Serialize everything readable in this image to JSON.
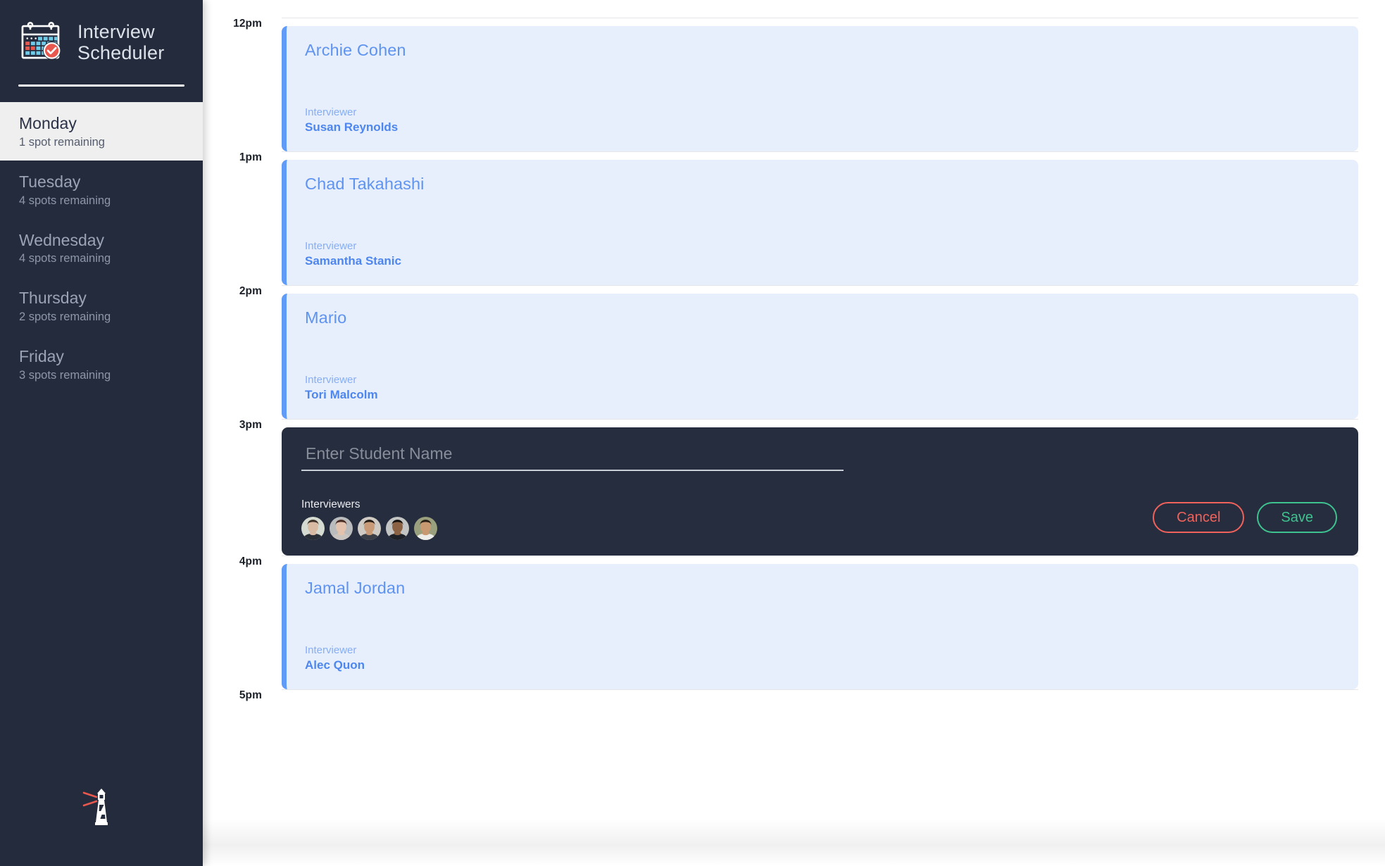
{
  "app": {
    "title_line1": "Interview",
    "title_line2": "Scheduler",
    "logo_icon": "calendar-check-icon",
    "footer_icon": "lighthouse-icon"
  },
  "sidebar": {
    "items": [
      {
        "day": "Monday",
        "spots": "1 spot remaining",
        "selected": true
      },
      {
        "day": "Tuesday",
        "spots": "4 spots remaining",
        "selected": false
      },
      {
        "day": "Wednesday",
        "spots": "4 spots remaining",
        "selected": false
      },
      {
        "day": "Thursday",
        "spots": "2 spots remaining",
        "selected": false
      },
      {
        "day": "Friday",
        "spots": "3 spots remaining",
        "selected": false
      }
    ]
  },
  "schedule": {
    "interviewer_label": "Interviewer",
    "hours": [
      {
        "time": "12pm",
        "type": "appointment",
        "student": "Archie Cohen",
        "interviewer": "Susan Reynolds"
      },
      {
        "time": "1pm",
        "type": "appointment",
        "student": "Chad Takahashi",
        "interviewer": "Samantha Stanic"
      },
      {
        "time": "2pm",
        "type": "appointment",
        "student": "Mario",
        "interviewer": "Tori Malcolm"
      },
      {
        "time": "3pm",
        "type": "form"
      },
      {
        "time": "4pm",
        "type": "appointment",
        "student": "Jamal Jordan",
        "interviewer": "Alec Quon"
      },
      {
        "time": "5pm",
        "type": "empty"
      }
    ]
  },
  "form": {
    "student_placeholder": "Enter Student Name",
    "student_value": "",
    "interviewers_label": "Interviewers",
    "cancel_label": "Cancel",
    "save_label": "Save",
    "interviewers": [
      {
        "name": "interviewer-avatar-1",
        "skin": "#D9BBA4",
        "hair": "#3E3228",
        "shirt": "#2A2E36",
        "bg": "#D6DBD2"
      },
      {
        "name": "interviewer-avatar-2",
        "skin": "#E3C3AE",
        "hair": "#4A2C24",
        "shirt": "#C9C4C0",
        "bg": "#B9BBBC"
      },
      {
        "name": "interviewer-avatar-3",
        "skin": "#C89A77",
        "hair": "#231A14",
        "shirt": "#3A3F47",
        "bg": "#CFCBC4"
      },
      {
        "name": "interviewer-avatar-4",
        "skin": "#8B6244",
        "hair": "#14100D",
        "shirt": "#1E2228",
        "bg": "#C3C5C4"
      },
      {
        "name": "interviewer-avatar-5",
        "skin": "#C99A72",
        "hair": "#2A2018",
        "shirt": "#EDEDE9",
        "bg": "#9AA07E"
      }
    ]
  },
  "colors": {
    "sidebar_bg": "#242B3D",
    "card_bg": "#E7EFFD",
    "card_accent": "#5F9BF7",
    "form_bg": "#262D3E",
    "cancel": "#F0625B",
    "save": "#3EC28F"
  }
}
